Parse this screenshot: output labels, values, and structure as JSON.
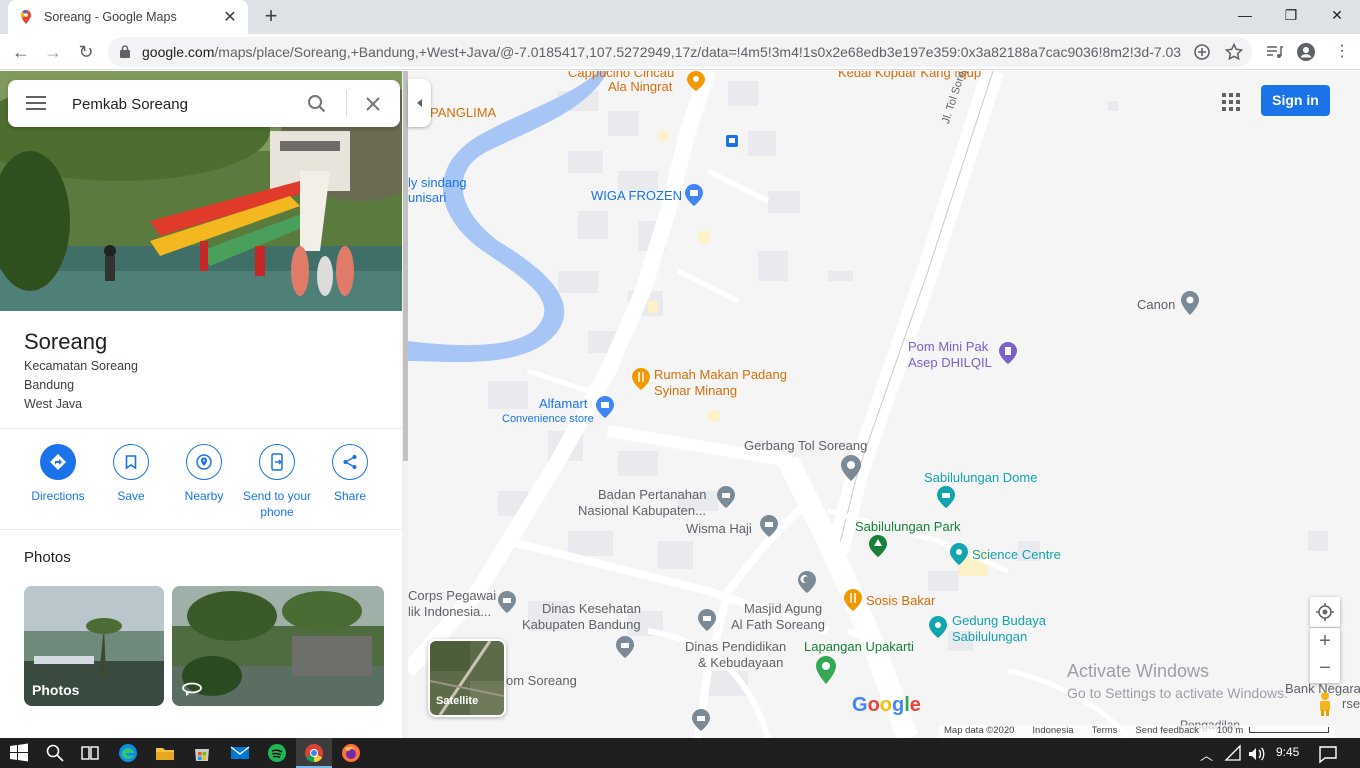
{
  "browser": {
    "tab_title": "Soreang - Google Maps",
    "url_host": "google.com",
    "url_path": "/maps/place/Soreang,+Bandung,+West+Java/@-7.0185417,107.5272949,17z/data=!4m5!3m4!1s0x2e68edb3e197e359:0x3a82188a7cac9036!8m2!3d-7.03..."
  },
  "search": {
    "value": "Pemkab Soreang"
  },
  "place": {
    "title": "Soreang",
    "address_lines": [
      "Kecamatan Soreang",
      "Bandung",
      "West Java"
    ]
  },
  "actions": [
    {
      "label": "Directions",
      "icon": "directions-icon"
    },
    {
      "label": "Save",
      "icon": "bookmark-icon"
    },
    {
      "label": "Nearby",
      "icon": "nearby-icon"
    },
    {
      "label": "Send to your phone",
      "icon": "send-to-phone-icon"
    },
    {
      "label": "Share",
      "icon": "share-icon"
    }
  ],
  "photos": {
    "heading": "Photos",
    "items": [
      {
        "label": "Photos"
      },
      {
        "label": ""
      }
    ]
  },
  "map": {
    "signin": "Sign in",
    "satellite_label": "Satellite",
    "google_logo": "Google",
    "labels": {
      "cappucino": "Cappucino Cincau",
      "ala_ningrat": "Ala Ningrat",
      "kedai": "Kedai Kopdar Kang Njup",
      "panglima": "PANGLIMA",
      "sindang": "ly sindang",
      "nisari": "unisari",
      "wiga": "WIGA FROZEN",
      "tol_soroja": "Jl. Tol Soroja",
      "canon": "Canon",
      "pom_1": "Pom Mini Pak",
      "pom_2": "Asep DHILQIL",
      "rumah_1": "Rumah Makan Padang",
      "rumah_2": "Syinar Minang",
      "alfamart": "Alfamart",
      "alfamart_sub": "Convenience store",
      "gerbang": "Gerbang Tol Soreang",
      "dome": "Sabilulungan Dome",
      "bpn_1": "Badan Pertanahan",
      "bpn_2": "Nasional Kabupaten...",
      "wisma": "Wisma Haji",
      "park": "Sabilulungan Park",
      "science": "Science Centre",
      "korps_1": "Corps Pegawai",
      "korps_2": "lik Indonesia...",
      "dinkes_1": "Dinas Kesehatan",
      "dinkes_2": "Kabupaten Bandung",
      "masjid_1": "Masjid Agung",
      "masjid_2": "Al Fath Soreang",
      "sosis": "Sosis Bakar",
      "gedung_1": "Gedung Budaya",
      "gedung_2": "Sabilulungan",
      "dinpen_1": "Dinas Pendidikan",
      "dinpen_2": "& Kebudayaan",
      "lapangan": "Lapangan Upakarti",
      "om_soreang": "om Soreang",
      "bank_1": "Bank Negara",
      "bank_2": "rse",
      "pengadilan": "Pengadilan"
    },
    "activate_1": "Activate Windows",
    "activate_2": "Go to Settings to activate Windows.",
    "footer": {
      "map_data": "Map data ©2020",
      "country": "Indonesia",
      "terms": "Terms",
      "feedback": "Send feedback",
      "scale": "100 m"
    }
  },
  "taskbar": {
    "time": "9:45"
  }
}
